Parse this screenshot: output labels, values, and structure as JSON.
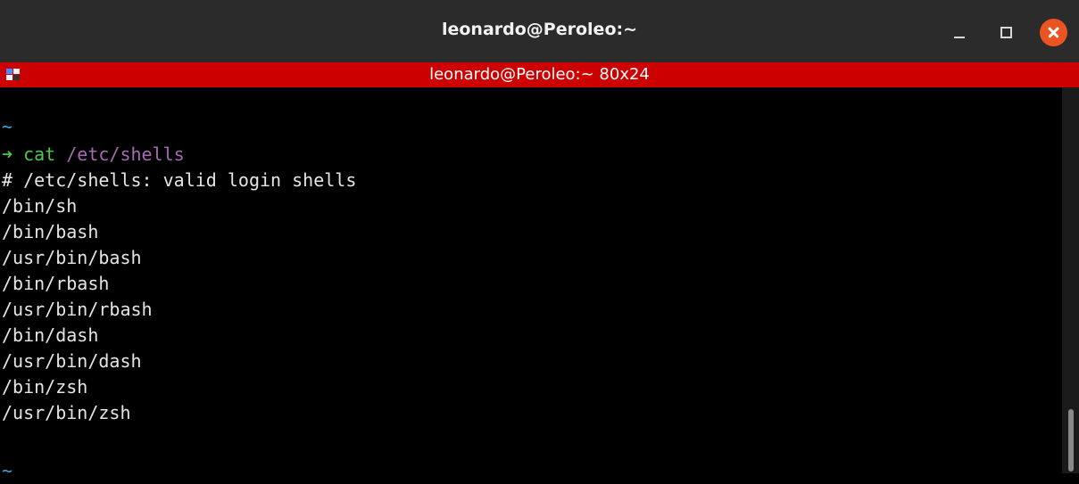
{
  "window": {
    "title": "leonardo@Peroleo:~",
    "controls": [
      "minimize-icon",
      "maximize-icon",
      "close-icon"
    ]
  },
  "subtitle_bar": {
    "title": "leonardo@Peroleo:~ 80x24",
    "color": "#cc0000"
  },
  "terminal": {
    "prompt_dir_top": "~",
    "prompt_arrow": "➜",
    "command": "cat",
    "argument": "/etc/shells",
    "output": [
      "# /etc/shells: valid login shells",
      "/bin/sh",
      "/bin/bash",
      "/usr/bin/bash",
      "/bin/rbash",
      "/usr/bin/rbash",
      "/bin/dash",
      "/usr/bin/dash",
      "/bin/zsh",
      "/usr/bin/zsh"
    ],
    "prompt_dir_bottom": "~"
  },
  "colors": {
    "titlebar": "#2b2b2b",
    "close_button": "#e95420",
    "prompt_dir": "#34a4d8",
    "prompt_arrow": "#4ec94e",
    "argument": "#a86ab4"
  }
}
